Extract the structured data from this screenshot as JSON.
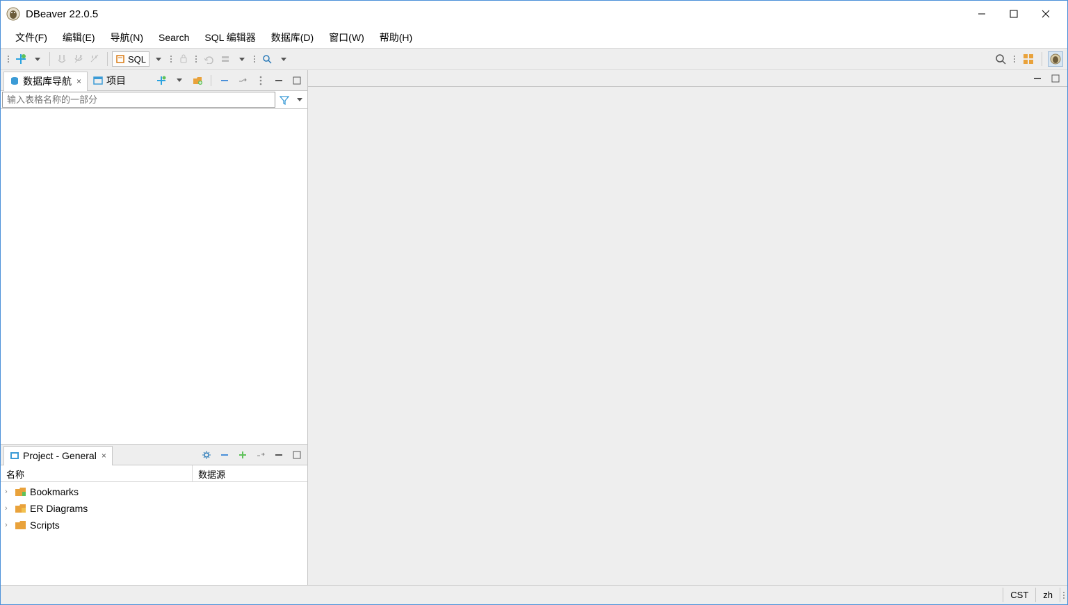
{
  "app": {
    "title": "DBeaver 22.0.5"
  },
  "menu": {
    "file": "文件(F)",
    "edit": "编辑(E)",
    "nav": "导航(N)",
    "search": "Search",
    "sqleditor": "SQL 编辑器",
    "database": "数据库(D)",
    "window": "窗口(W)",
    "help": "帮助(H)"
  },
  "toolbar": {
    "sql_label": "SQL"
  },
  "navigator": {
    "tab_db_nav": "数据库导航",
    "tab_projects": "项目",
    "filter_placeholder": "输入表格名称的一部分"
  },
  "project": {
    "tab_title": "Project - General",
    "col_name": "名称",
    "col_datasource": "数据源",
    "items": [
      {
        "label": "Bookmarks"
      },
      {
        "label": "ER Diagrams"
      },
      {
        "label": "Scripts"
      }
    ]
  },
  "status": {
    "tz": "CST",
    "locale": "zh"
  }
}
